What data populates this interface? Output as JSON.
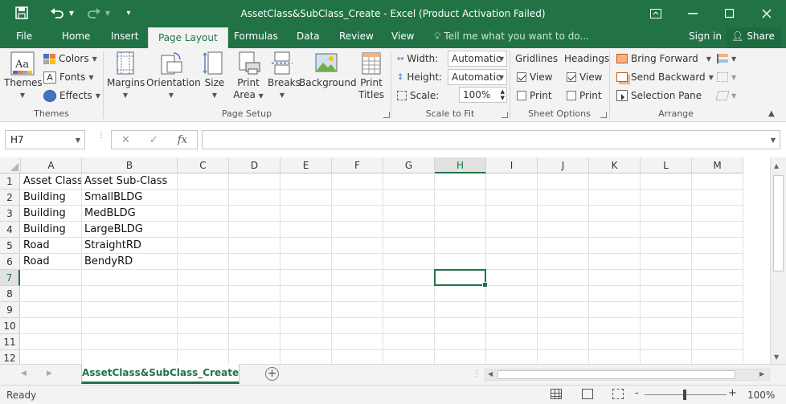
{
  "window": {
    "title": "AssetClass&SubClass_Create - Excel (Product Activation Failed)"
  },
  "tabs": [
    {
      "label": "File"
    },
    {
      "label": "Home"
    },
    {
      "label": "Insert"
    },
    {
      "label": "Page Layout"
    },
    {
      "label": "Formulas"
    },
    {
      "label": "Data"
    },
    {
      "label": "Review"
    },
    {
      "label": "View"
    }
  ],
  "active_tab": "Page Layout",
  "tellme": "Tell me what you want to do...",
  "signin": "Sign in",
  "share": "Share",
  "ribbon": {
    "themes": {
      "themes_label": "Themes",
      "colors_label": "Colors",
      "fonts_label": "Fonts",
      "effects_label": "Effects",
      "group": "Themes"
    },
    "page_setup": {
      "margins": "Margins",
      "orientation": "Orientation",
      "size": "Size",
      "print_area_1": "Print",
      "print_area_2": "Area",
      "breaks": "Breaks",
      "background": "Background",
      "print_titles_1": "Print",
      "print_titles_2": "Titles",
      "group": "Page Setup"
    },
    "scale": {
      "width_label": "Width:",
      "width_value": "Automatic",
      "height_label": "Height:",
      "height_value": "Automatic",
      "scale_label": "Scale:",
      "scale_value": "100%",
      "group": "Scale to Fit"
    },
    "sheet_options": {
      "gridlines": "Gridlines",
      "headings": "Headings",
      "view": "View",
      "print": "Print",
      "gridlines_view": true,
      "gridlines_print": false,
      "headings_view": true,
      "headings_print": false,
      "group": "Sheet Options"
    },
    "arrange": {
      "bring_forward": "Bring Forward",
      "send_backward": "Send Backward",
      "selection_pane": "Selection Pane",
      "group": "Arrange"
    }
  },
  "formula_bar": {
    "name_box": "H7",
    "fx": "fx",
    "formula": ""
  },
  "columns": [
    "A",
    "B",
    "C",
    "D",
    "E",
    "F",
    "G",
    "H",
    "I",
    "J",
    "K",
    "L",
    "M"
  ],
  "rows": [
    "1",
    "2",
    "3",
    "4",
    "5",
    "6",
    "7",
    "8",
    "9",
    "10",
    "11",
    "12"
  ],
  "cells": [
    [
      "Asset Class",
      "Asset Sub-Class"
    ],
    [
      "Building",
      "SmallBLDG"
    ],
    [
      "Building",
      "MedBLDG"
    ],
    [
      "Building",
      "LargeBLDG"
    ],
    [
      "Road",
      "StraightRD"
    ],
    [
      "Road",
      "BendyRD"
    ]
  ],
  "active_cell": "H7",
  "sheet": {
    "tab": "AssetClass&SubClass_Create"
  },
  "status": {
    "ready": "Ready",
    "zoom": "100%",
    "zoom_minus": "-",
    "zoom_plus": "+"
  },
  "colors": {
    "accent": "#217346"
  }
}
